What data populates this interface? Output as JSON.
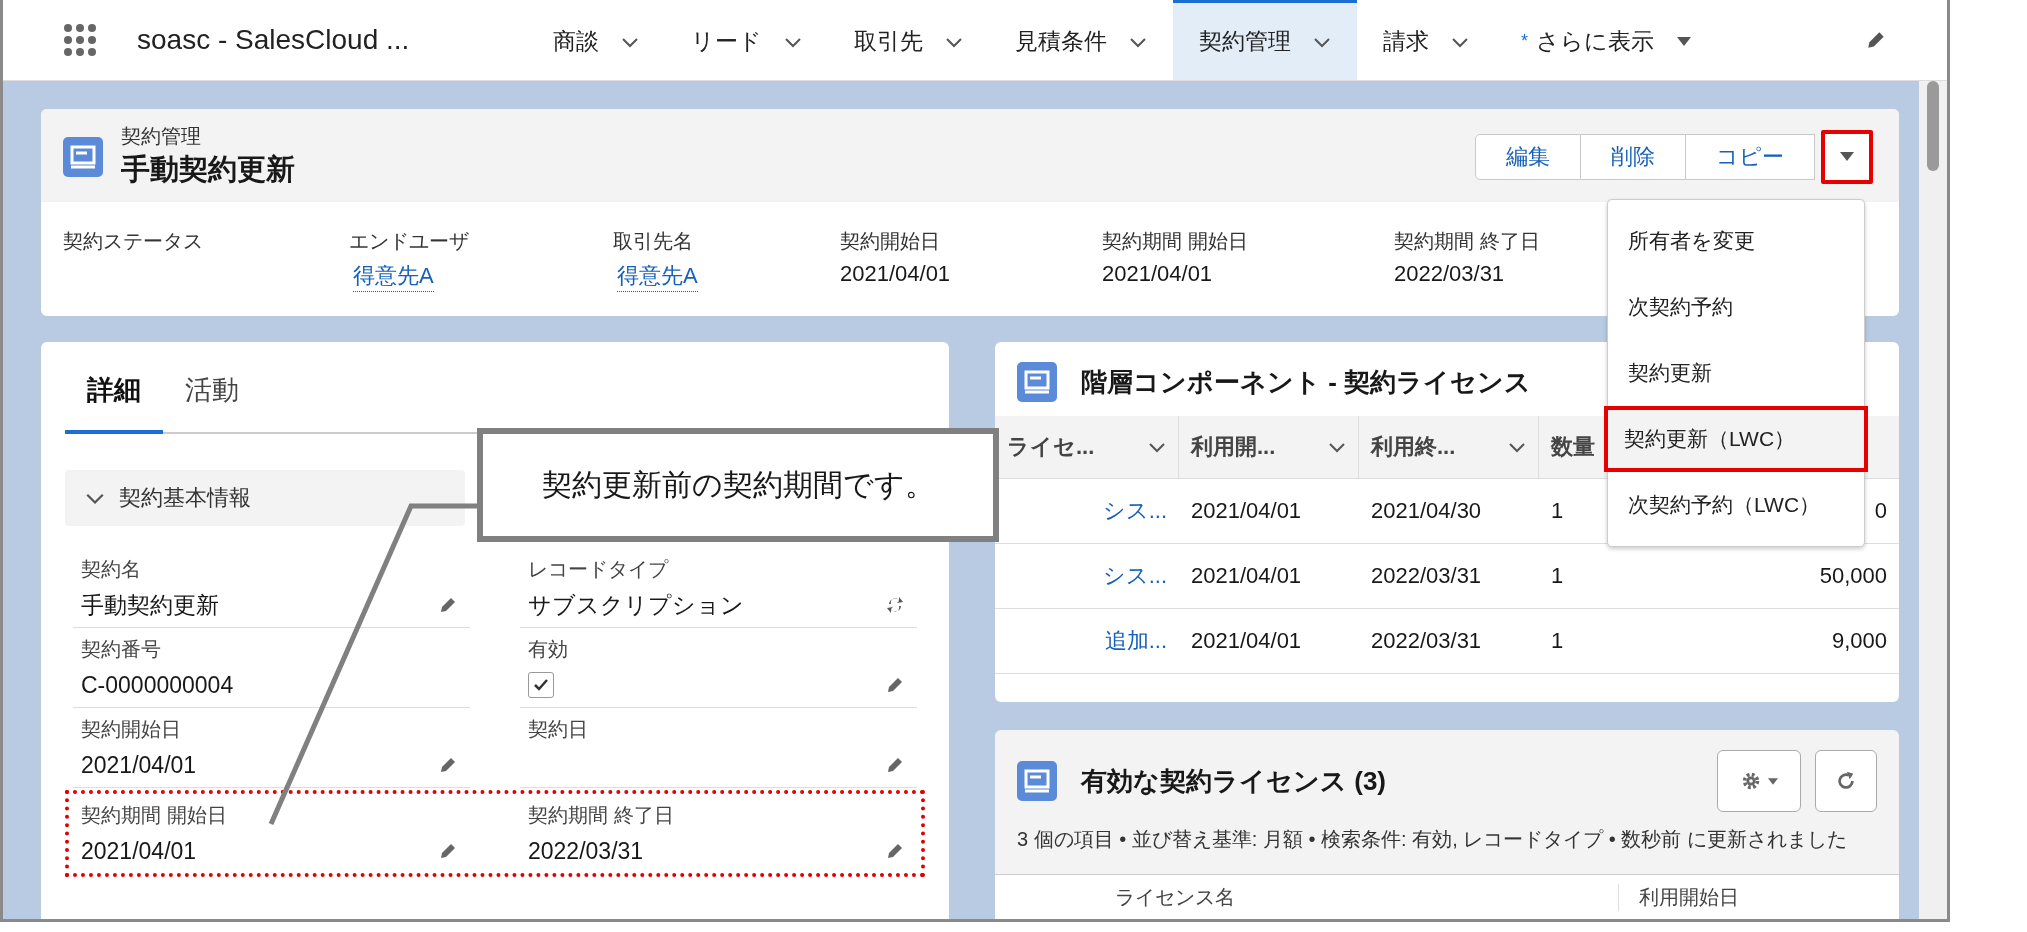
{
  "nav": {
    "app_name": "soasc - SalesCloud ...",
    "tabs": [
      {
        "label": "商談",
        "selected": false
      },
      {
        "label": "リード",
        "selected": false
      },
      {
        "label": "取引先",
        "selected": false
      },
      {
        "label": "見積条件",
        "selected": false
      },
      {
        "label": "契約管理",
        "selected": true
      },
      {
        "label": "請求",
        "selected": false
      }
    ],
    "more": {
      "marker": "*",
      "label": "さらに表示"
    }
  },
  "record_header": {
    "object_label": "契約管理",
    "title": "手動契約更新",
    "buttons": [
      {
        "label": "編集"
      },
      {
        "label": "削除"
      },
      {
        "label": "コピー"
      }
    ],
    "menu_button": {
      "highlighted": true
    },
    "fields": [
      {
        "label": "契約ステータス"
      },
      {
        "label": "エンドユーザ",
        "value": "得意先A",
        "link": true
      },
      {
        "label": "取引先名",
        "value": "得意先A",
        "link": true
      },
      {
        "label": "契約開始日",
        "value": "2021/04/01",
        "link": false
      },
      {
        "label": "契約期間 開始日",
        "value": "2021/04/01",
        "link": false
      },
      {
        "label": "契約期間 終了日",
        "value": "2022/03/31",
        "link": false
      }
    ]
  },
  "actions_menu": [
    {
      "label": "所有者を変更",
      "selected": false,
      "highlighted": false
    },
    {
      "label": "次契約予約",
      "selected": false,
      "highlighted": false
    },
    {
      "label": "契約更新",
      "selected": false,
      "highlighted": false
    },
    {
      "label": "契約更新（LWC）",
      "selected": true,
      "highlighted": true
    },
    {
      "label": "次契約予約（LWC）",
      "selected": false,
      "highlighted": false
    }
  ],
  "detail_panel": {
    "tabs": [
      {
        "label": "詳細",
        "selected": true
      },
      {
        "label": "活動",
        "selected": false
      }
    ],
    "section": {
      "title": "契約基本情報",
      "expanded": true
    },
    "fields": [
      {
        "label": "契約名",
        "kind": "text",
        "value": "手動契約更新",
        "editable": true,
        "highlighted": false
      },
      {
        "label": "レコードタイプ",
        "kind": "record_type",
        "value": "サブスクリプション",
        "editable": true,
        "highlighted": false
      },
      {
        "label": "契約番号",
        "kind": "text",
        "value": "C-0000000004",
        "editable": false,
        "highlighted": false
      },
      {
        "label": "有効",
        "kind": "checkbox",
        "checked": true,
        "editable": true,
        "highlighted": false
      },
      {
        "label": "契約開始日",
        "kind": "text",
        "value": "2021/04/01",
        "editable": true,
        "highlighted": false
      },
      {
        "label": "契約日",
        "kind": "text",
        "editable": true,
        "highlighted": false
      },
      {
        "label": "契約期間 開始日",
        "kind": "text",
        "value": "2021/04/01",
        "editable": true,
        "highlighted": true
      },
      {
        "label": "契約期間 終了日",
        "kind": "text",
        "value": "2022/03/31",
        "editable": true,
        "highlighted": true
      }
    ]
  },
  "callout": {
    "text": "契約更新前の契約期間です。"
  },
  "hierarchy_panel": {
    "title": "階層コンポーネント - 契約ライセンス",
    "columns": [
      "ライセ...",
      "利用開...",
      "利用終...",
      "数量"
    ],
    "rows": [
      {
        "cells": [
          "シス...",
          "2021/04/01",
          "2021/04/30",
          "1",
          "0"
        ]
      },
      {
        "cells": [
          "シス...",
          "2021/04/01",
          "2022/03/31",
          "1",
          "50,000"
        ]
      },
      {
        "cells": [
          "追加...",
          "2021/04/01",
          "2022/03/31",
          "1",
          "9,000"
        ]
      }
    ]
  },
  "licenses_panel": {
    "title": "有効な契約ライセンス (3)",
    "summary": "3 個の項目 • 並び替え基準: 月額 • 検索条件: 有効, レコードタイプ • 数秒前 に更新されました",
    "columns": [
      "ライセンス名",
      "利用開始日"
    ]
  }
}
